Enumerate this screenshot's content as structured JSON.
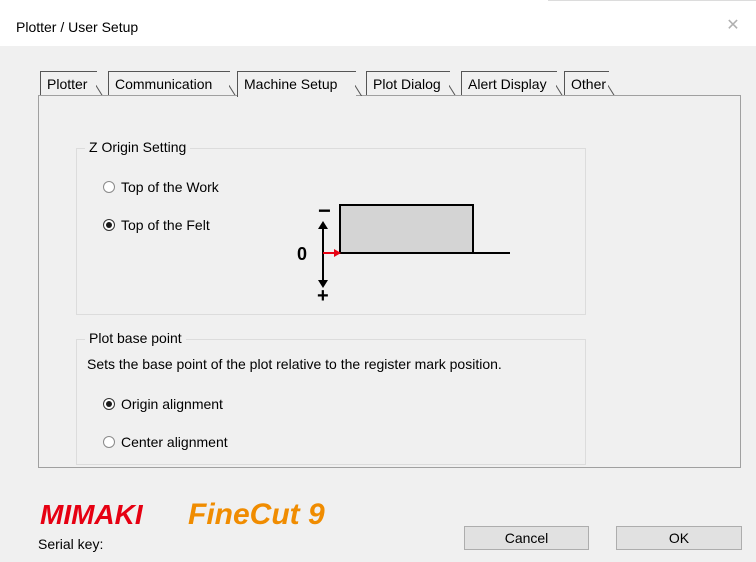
{
  "window": {
    "title": "Plotter / User Setup",
    "close_icon": "close-icon"
  },
  "tabs": [
    {
      "label": "Plotter",
      "active": false
    },
    {
      "label": "Communication",
      "active": false
    },
    {
      "label": "Machine Setup",
      "active": true
    },
    {
      "label": "Plot Dialog",
      "active": false
    },
    {
      "label": "Alert Display",
      "active": false
    },
    {
      "label": "Other",
      "active": false
    }
  ],
  "z_origin": {
    "title": "Z Origin Setting",
    "options": [
      {
        "label": "Top of the Work",
        "checked": false
      },
      {
        "label": "Top of the Felt",
        "checked": true
      }
    ],
    "diagram": {
      "minus": "−",
      "zero": "0",
      "plus": "+"
    }
  },
  "plot_base": {
    "title": "Plot base point",
    "description": "Sets the base point of the plot relative to the register mark position.",
    "options": [
      {
        "label": "Origin alignment",
        "checked": true
      },
      {
        "label": "Center alignment",
        "checked": false
      }
    ]
  },
  "footer": {
    "brand_text": "MIMAKI",
    "product_text": "FineCut 9",
    "serial_label": "Serial key:",
    "cancel_label": "Cancel",
    "ok_label": "OK"
  },
  "colors": {
    "brand_red": "#e60012",
    "brand_orange": "#f08c00",
    "arrow_red": "#e60012"
  }
}
